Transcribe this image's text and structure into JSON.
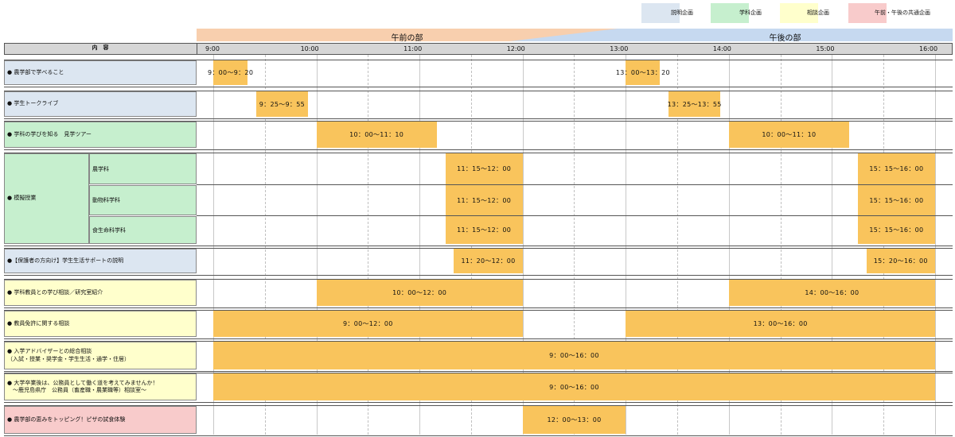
{
  "legend": [
    {
      "label": "説明企画",
      "color": "#dce6f1"
    },
    {
      "label": "学科企画",
      "color": "#c6efce"
    },
    {
      "label": "相談企画",
      "color": "#ffffcc"
    },
    {
      "label": "午前・午後の共通企画",
      "color": "#f8cbcb"
    }
  ],
  "header": {
    "am": "午前の部",
    "pm": "午後の部",
    "content": "内　容",
    "times": [
      "9:00",
      "10:00",
      "11:00",
      "12:00",
      "13:00",
      "14:00",
      "15:00",
      "16:00"
    ]
  },
  "colors": {
    "bar": "#f9c45c",
    "am_banner": "#f8cfae",
    "pm_banner": "#c6d9f0"
  },
  "rows": [
    {
      "label": "● 農学部で学べること",
      "color": "#dce6f1",
      "bars": [
        {
          "start": "9:00",
          "end": "9:20",
          "text": "9：00～9：20"
        },
        {
          "start": "13:00",
          "end": "13:20",
          "text": "13：00～13：20"
        }
      ]
    },
    {
      "label": "● 学生トークライブ",
      "color": "#dce6f1",
      "bars": [
        {
          "start": "9:25",
          "end": "9:55",
          "text": "9：25～9：55"
        },
        {
          "start": "13:25",
          "end": "13:55",
          "text": "13：25～13：55"
        }
      ]
    },
    {
      "label": "● 学科の学びを知る　見学ツアー",
      "color": "#c6efce",
      "bars": [
        {
          "start": "10:00",
          "end": "11:10",
          "text": "10：00～11：10"
        },
        {
          "start": "14:00",
          "end": "15:10",
          "text": "10：00～11：10"
        }
      ]
    },
    {
      "label": "● 模擬授業",
      "color": "#c6efce",
      "subs": [
        {
          "label": "農学科",
          "bars": [
            {
              "start": "11:15",
              "end": "12:00",
              "text": "11：15～12：00"
            },
            {
              "start": "15:15",
              "end": "16:00",
              "text": "15：15～16：00"
            }
          ]
        },
        {
          "label": "動物科学科",
          "bars": [
            {
              "start": "11:15",
              "end": "12:00",
              "text": "11：15～12：00"
            },
            {
              "start": "15:15",
              "end": "16:00",
              "text": "15：15～16：00"
            }
          ]
        },
        {
          "label": "食生命科学科",
          "bars": [
            {
              "start": "11:15",
              "end": "12:00",
              "text": "11：15～12：00"
            },
            {
              "start": "15:15",
              "end": "16:00",
              "text": "15：15～16：00"
            }
          ]
        }
      ]
    },
    {
      "label": "●【保護者の方向け】学生生活サポートの説明",
      "color": "#dce6f1",
      "bars": [
        {
          "start": "11:20",
          "end": "12:00",
          "text": "11：20～12：00"
        },
        {
          "start": "15:20",
          "end": "16:00",
          "text": "15：20～16：00"
        }
      ]
    },
    {
      "label": "● 学科教員との学び相談／研究室紹介",
      "color": "#ffffcc",
      "bars": [
        {
          "start": "10:00",
          "end": "12:00",
          "text": "10：00～12：00"
        },
        {
          "start": "14:00",
          "end": "16:00",
          "text": "14：00～16：00"
        }
      ]
    },
    {
      "label": "● 教員免許に関する相談",
      "color": "#ffffcc",
      "bars": [
        {
          "start": "9:00",
          "end": "12:00",
          "text": "9：00～12：00"
        },
        {
          "start": "13:00",
          "end": "16:00",
          "text": "13：00～16：00"
        }
      ]
    },
    {
      "label": "● 入学アドバイザーとの総合相談\n（入試・授業・奨学金・学生生活・通学・住居）",
      "color": "#ffffcc",
      "bars": [
        {
          "start": "9:00",
          "end": "16:00",
          "text": "9：00～16：00"
        }
      ]
    },
    {
      "label": "● 大学卒業後は、公務員として働く道を考えてみませんか！\n　～鹿児島県庁　公務員（畜産職・農業職等）相談室～",
      "color": "#ffffcc",
      "bars": [
        {
          "start": "9:00",
          "end": "16:00",
          "text": "9：00～16：00"
        }
      ]
    },
    {
      "label": "● 農学部の恵みをトッピング！ピザの試食体験",
      "color": "#f8cbcb",
      "bars": [
        {
          "start": "12:00",
          "end": "13:00",
          "text": "12：00～13：00"
        }
      ]
    }
  ]
}
